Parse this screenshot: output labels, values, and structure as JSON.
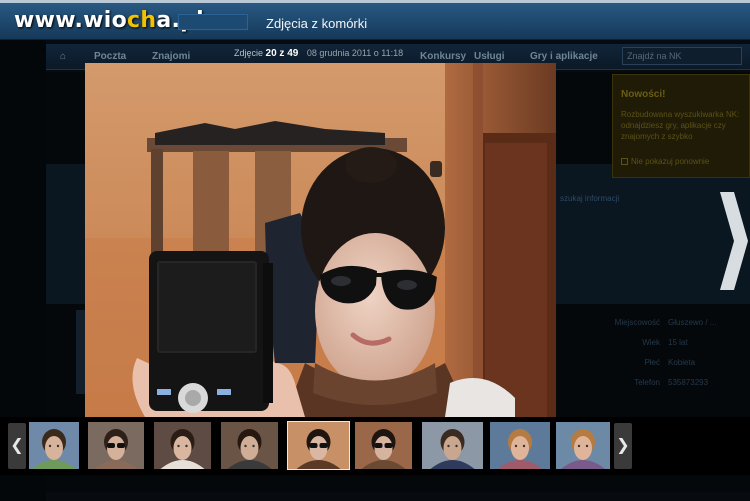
{
  "site": {
    "watermark_prefix": "www.wio",
    "watermark_smiley": "ch",
    "watermark_suffix": "a.pl"
  },
  "header": {
    "album_title": "Zdjęcia z komórki"
  },
  "nav": {
    "items": [
      "Poczta",
      "Znajomi",
      "Konkursy",
      "Usługi",
      "Gry i aplikacje"
    ],
    "search_placeholder": "Znajdź na NK"
  },
  "notification": {
    "title": "Nowości!",
    "body": "Rozbudowana wyszukiwarka NK: odnajdziesz gry, aplikacje czy znajomych z szybko",
    "checkbox_label": "Nie pokazuj ponownie"
  },
  "profile": {
    "link_text": "szukaj informacji",
    "rows": [
      {
        "label": "Miejscowość",
        "value": "Głuszewo / ..."
      },
      {
        "label": "Wiek",
        "value": "15 lat"
      },
      {
        "label": "Płeć",
        "value": "Kobieta"
      },
      {
        "label": "Telefon",
        "value": "535873293"
      }
    ]
  },
  "lightbox": {
    "counter_prefix": "Zdjęcie",
    "current": "20 z 49",
    "date": "08 grudnia 2011 o 11:18",
    "prev_glyph": "❮",
    "next_glyph": "❯"
  },
  "thumbnails": [
    {
      "bg": "#6f8aa8",
      "face": "#d7b39b",
      "hair": "#3a2a1c",
      "shirt": "#6e9a5a",
      "glasses": false,
      "active": false
    },
    {
      "bg": "#7a6a60",
      "face": "#d3b19a",
      "hair": "#2e2018",
      "shirt": "#8a6a58",
      "glasses": true,
      "active": false
    },
    {
      "bg": "#5e4c44",
      "face": "#d9b6a0",
      "hair": "#2a1d15",
      "shirt": "#e6e0d8",
      "glasses": false,
      "active": false
    },
    {
      "bg": "#6a5446",
      "face": "#d0ad96",
      "hair": "#241811",
      "shirt": "#3a3a3a",
      "glasses": false,
      "active": false
    },
    {
      "bg": "#c89066",
      "face": "#d9b7a2",
      "hair": "#1e1510",
      "shirt": "#5a3a26",
      "glasses": true,
      "active": true
    },
    {
      "bg": "#9a6848",
      "face": "#d6b39e",
      "hair": "#1e1510",
      "shirt": "#6b4a33",
      "glasses": true,
      "active": false
    },
    {
      "bg": "#8d98a6",
      "face": "#c9a78f",
      "hair": "#3a2a20",
      "shirt": "#2e3b5c",
      "glasses": false,
      "active": false
    },
    {
      "bg": "#5d7a9a",
      "face": "#e0b49a",
      "hair": "#b57b41",
      "shirt": "#a05a6a",
      "glasses": false,
      "active": false
    },
    {
      "bg": "#6c8aa6",
      "face": "#e0b49a",
      "hair": "#b57b41",
      "shirt": "#7a5a8a",
      "glasses": false,
      "active": false
    }
  ],
  "colors": {
    "header_top": "#2a5b86",
    "header_bottom": "#16395a",
    "lightbox_backdrop": "#000000"
  }
}
